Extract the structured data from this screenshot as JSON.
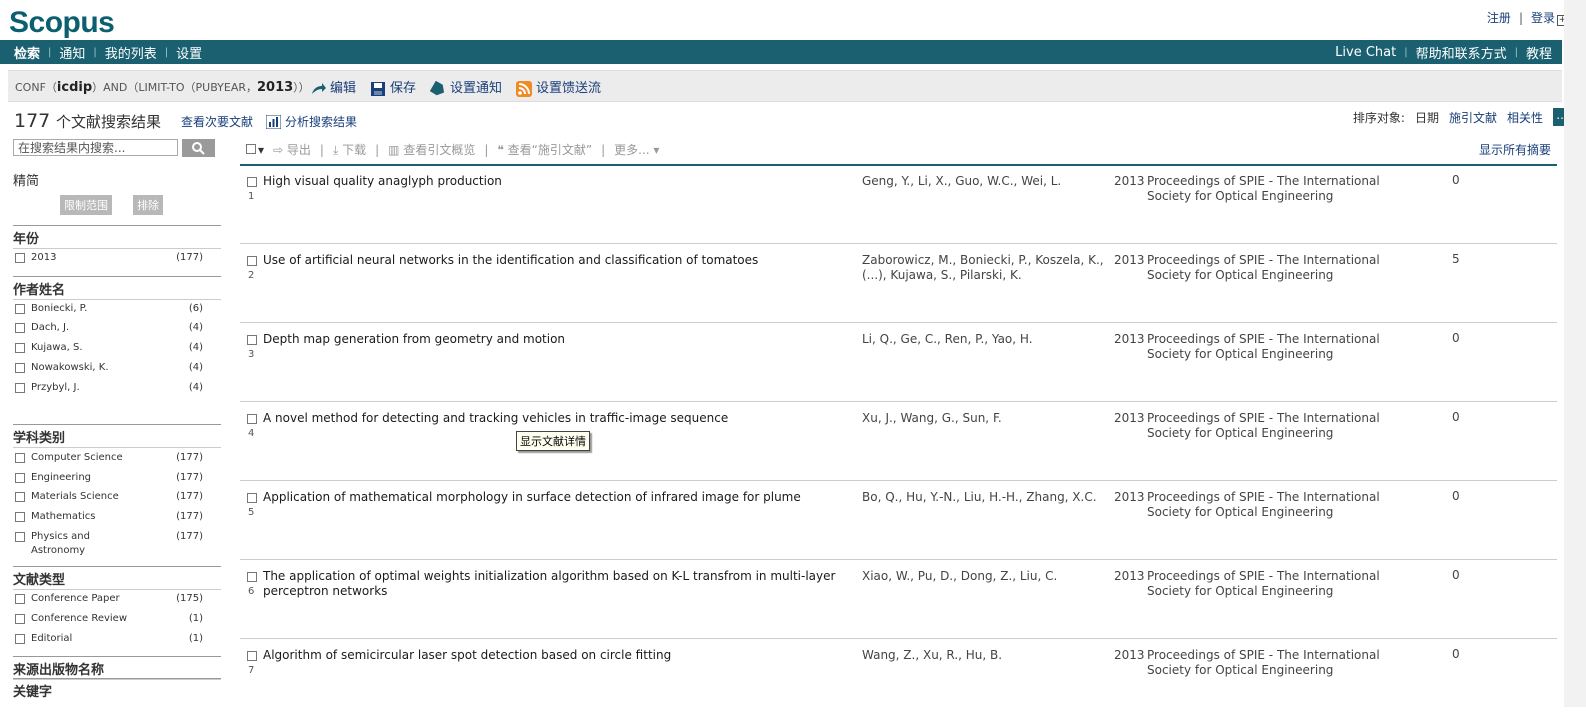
{
  "header": {
    "logo": "Scopus",
    "register": "注册",
    "login": "登录"
  },
  "nav": {
    "left": [
      "检索",
      "通知",
      "我的列表",
      "设置"
    ],
    "right": [
      "Live Chat",
      "帮助和联系方式",
      "教程"
    ]
  },
  "query": {
    "prefix": "CONF（",
    "term1": "icdip",
    "mid": "）AND（LIMIT-TO（PUBYEAR，",
    "term2": "2013",
    "suffix": "））",
    "actions": [
      "编辑",
      "保存",
      "设置通知",
      "设置馈送流"
    ]
  },
  "results": {
    "count": "177",
    "count_label": "个文献搜索结果",
    "secondary_link": "查看次要文献",
    "analyze_link": "分析搜索结果",
    "sort_label": "排序对象:",
    "sort_options": [
      "日期",
      "施引文献",
      "相关性"
    ],
    "sort_more": "...",
    "show_all": "显示所有摘要"
  },
  "toolbar": {
    "export": "导出",
    "download": "下载",
    "citation_overview": "查看引文概览",
    "view_cited": "查看“施引文献”",
    "more": "更多..."
  },
  "sidebar": {
    "search_placeholder": "在搜索结果内搜索...",
    "refine": "精简",
    "limit_btn": "限制范围",
    "exclude_btn": "排除",
    "year": {
      "title": "年份",
      "items": [
        {
          "name": "2013",
          "count": "(177)"
        }
      ]
    },
    "author": {
      "title": "作者姓名",
      "items": [
        {
          "name": "Boniecki, P.",
          "count": "(6)"
        },
        {
          "name": "Dach, J.",
          "count": "(4)"
        },
        {
          "name": "Kujawa, S.",
          "count": "(4)"
        },
        {
          "name": "Nowakowski, K.",
          "count": "(4)"
        },
        {
          "name": "Przybyl, J.",
          "count": "(4)"
        }
      ]
    },
    "subject": {
      "title": "学科类别",
      "items": [
        {
          "name": "Computer Science",
          "count": "(177)"
        },
        {
          "name": "Engineering",
          "count": "(177)"
        },
        {
          "name": "Materials Science",
          "count": "(177)"
        },
        {
          "name": "Mathematics",
          "count": "(177)"
        },
        {
          "name": "Physics and Astronomy",
          "count": "(177)"
        }
      ]
    },
    "doctype": {
      "title": "文献类型",
      "items": [
        {
          "name": "Conference Paper",
          "count": "(175)"
        },
        {
          "name": "Conference Review",
          "count": "(1)"
        },
        {
          "name": "Editorial",
          "count": "(1)"
        }
      ]
    },
    "source_title": "来源出版物名称",
    "keyword_title": "关键字"
  },
  "rows": [
    {
      "idx": "1",
      "title": "High visual quality anaglyph production",
      "authors": "Geng, Y., Li, X., Guo, W.C., Wei, L.",
      "year": "2013",
      "source": "Proceedings of SPIE - The International Society for Optical Engineering",
      "cites": "0"
    },
    {
      "idx": "2",
      "title": "Use of artificial neural networks in the identification and classification of tomatoes",
      "authors": "Zaborowicz, M., Boniecki, P., Koszela, K., (...), Kujawa, S., Pilarski, K.",
      "year": "2013",
      "source": "Proceedings of SPIE - The International Society for Optical Engineering",
      "cites": "5"
    },
    {
      "idx": "3",
      "title": "Depth map generation from geometry and motion",
      "authors": "Li, Q., Ge, C., Ren, P., Yao, H.",
      "year": "2013",
      "source": "Proceedings of SPIE - The International Society for Optical Engineering",
      "cites": "0"
    },
    {
      "idx": "4",
      "title": "A novel method for detecting and tracking vehicles in traffic-image sequence",
      "authors": "Xu, J., Wang, G., Sun, F.",
      "year": "2013",
      "source": "Proceedings of SPIE - The International Society for Optical Engineering",
      "cites": "0"
    },
    {
      "idx": "5",
      "title": "Application of mathematical morphology in surface detection of infrared image for plume",
      "authors": "Bo, Q., Hu, Y.-N., Liu, H.-H., Zhang, X.C.",
      "year": "2013",
      "source": "Proceedings of SPIE - The International Society for Optical Engineering",
      "cites": "0"
    },
    {
      "idx": "6",
      "title": "The application of optimal weights initialization algorithm based on K-L transfrom in multi-layer perceptron networks",
      "authors": "Xiao, W., Pu, D., Dong, Z., Liu, C.",
      "year": "2013",
      "source": "Proceedings of SPIE - The International Society for Optical Engineering",
      "cites": "0"
    },
    {
      "idx": "7",
      "title": "Algorithm of semicircular laser spot detection based on circle fitting",
      "authors": "Wang, Z., Xu, R., Hu, B.",
      "year": "2013",
      "source": "Proceedings of SPIE - The International Society for Optical Engineering",
      "cites": "0"
    }
  ],
  "tooltip": "显示文献详情",
  "colors": {
    "brand": "#1a6070",
    "link": "#1a3f7a"
  }
}
